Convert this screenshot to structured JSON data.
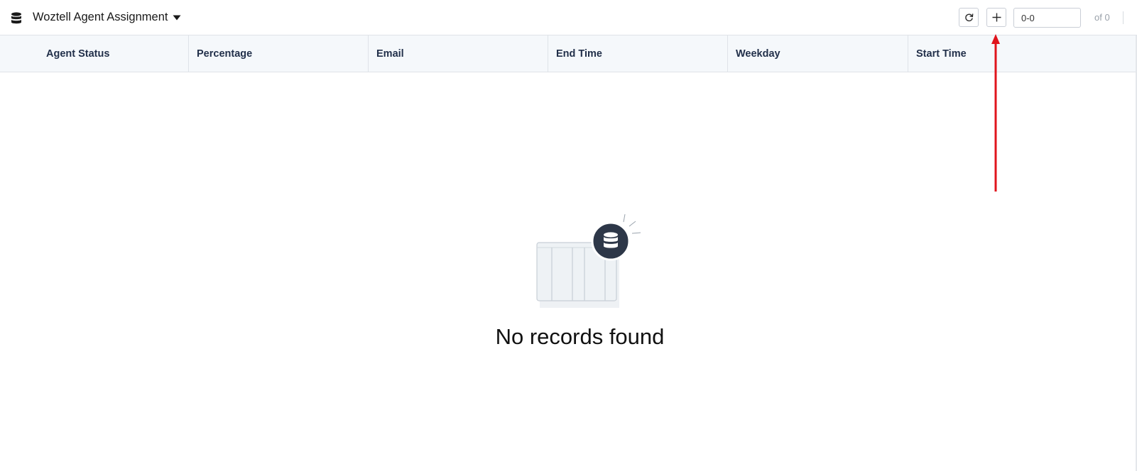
{
  "header": {
    "model_title": "Woztell Agent Assignment",
    "model_icon": "database-icon",
    "dropdown_icon": "caret-down-icon",
    "refresh_icon": "refresh-icon",
    "add_icon": "plus-icon",
    "range_value": "0-0",
    "total_label": "of 0"
  },
  "table": {
    "columns": [
      "Agent Status",
      "Percentage",
      "Email",
      "End Time",
      "Weekday",
      "Start Time"
    ]
  },
  "empty_state": {
    "icon": "database-icon",
    "message": "No records found"
  },
  "annotation": {
    "icon": "arrow-up-icon",
    "color": "#e0141c"
  },
  "colors": {
    "header_bg": "#f5f8fb",
    "border": "#dfe3e8",
    "column_text": "#22304a",
    "badge_bg": "#2d3748"
  }
}
